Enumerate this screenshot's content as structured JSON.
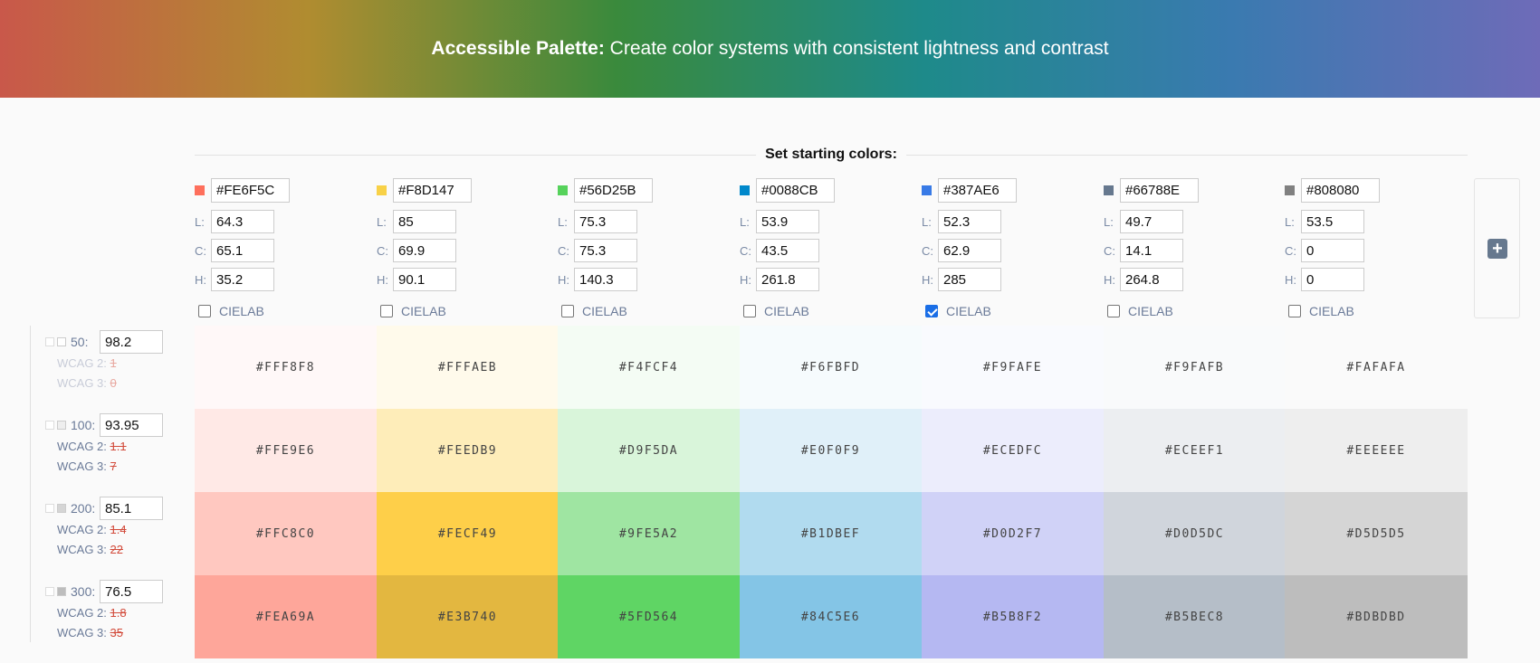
{
  "header": {
    "title_bold": "Accessible Palette:",
    "title_rest": " Create color systems with consistent lightness and contrast"
  },
  "section_title": "Set starting colors:",
  "labels": {
    "l": "L:",
    "c": "C:",
    "h": "H:",
    "cielab": "CIELAB",
    "wcag2": "WCAG 2: ",
    "wcag3": "WCAG 3: "
  },
  "add_button": "+",
  "colors": [
    {
      "hex": "#FE6F5C",
      "swatch": "#FE6F5C",
      "l": "64.3",
      "c": "65.1",
      "h": "35.2",
      "cielab": false
    },
    {
      "hex": "#F8D147",
      "swatch": "#F8D147",
      "l": "85",
      "c": "69.9",
      "h": "90.1",
      "cielab": false
    },
    {
      "hex": "#56D25B",
      "swatch": "#56D25B",
      "l": "75.3",
      "c": "75.3",
      "h": "140.3",
      "cielab": false
    },
    {
      "hex": "#0088CB",
      "swatch": "#0088CB",
      "l": "53.9",
      "c": "43.5",
      "h": "261.8",
      "cielab": false
    },
    {
      "hex": "#387AE6",
      "swatch": "#387AE6",
      "l": "52.3",
      "c": "62.9",
      "h": "285",
      "cielab": true
    },
    {
      "hex": "#66788E",
      "swatch": "#66788E",
      "l": "49.7",
      "c": "14.1",
      "h": "264.8",
      "cielab": false
    },
    {
      "hex": "#808080",
      "swatch": "#808080",
      "l": "53.5",
      "c": "0",
      "h": "0",
      "cielab": false
    }
  ],
  "scale": [
    {
      "step": "50:",
      "value": "98.2",
      "wcag2": "1",
      "wcag3": "0",
      "faint": true,
      "swatch": "#ffffff",
      "cells": [
        "#FFF8F8",
        "#FFFAEB",
        "#F4FCF4",
        "#F6FBFD",
        "#F9FAFE",
        "#F9FAFB",
        "#FAFAFA"
      ]
    },
    {
      "step": "100:",
      "value": "93.95",
      "wcag2": "1.1",
      "wcag3": "7",
      "faint": false,
      "swatch": "#eeeeee",
      "cells": [
        "#FFE9E6",
        "#FEEDB9",
        "#D9F5DA",
        "#E0F0F9",
        "#ECEDFC",
        "#ECEEF1",
        "#EEEEEE"
      ]
    },
    {
      "step": "200:",
      "value": "85.1",
      "wcag2": "1.4",
      "wcag3": "22",
      "faint": false,
      "swatch": "#d5d5d5",
      "cells": [
        "#FFC8C0",
        "#FECF49",
        "#9FE5A2",
        "#B1DBEF",
        "#D0D2F7",
        "#D0D5DC",
        "#D5D5D5"
      ]
    },
    {
      "step": "300:",
      "value": "76.5",
      "wcag2": "1.8",
      "wcag3": "35",
      "faint": false,
      "swatch": "#bdbdbd",
      "cells": [
        "#FEA69A",
        "#E3B740",
        "#5FD564",
        "#84C5E6",
        "#B5B8F2",
        "#B5BEC8",
        "#BDBDBD"
      ]
    }
  ]
}
